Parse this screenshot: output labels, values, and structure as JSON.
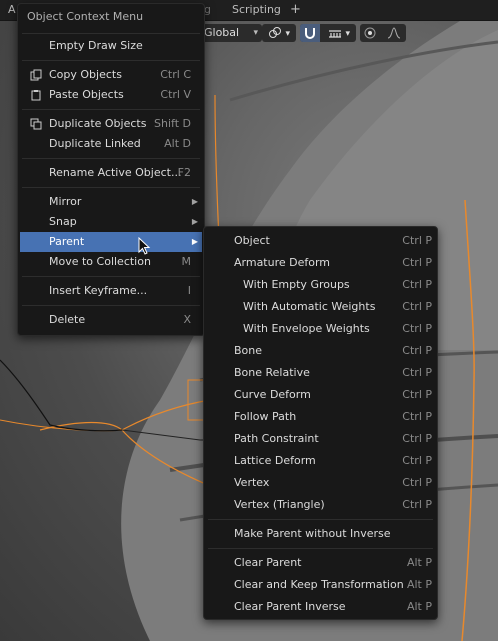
{
  "topbar": {
    "tab_partial_left": "A",
    "tab_partial_mid": "...scaping",
    "tab_scripting": "Scripting",
    "tab_add": "+"
  },
  "toolbar": {
    "orientation": "Global",
    "orientation_icon": "orientation-icon",
    "pivot_icon": "link-icon",
    "snap_icon": "magnet-icon",
    "snap_target_icon": "grid-snap-icon",
    "proportional_icon": "proportional-edit-icon",
    "falloff_icon": "falloff-curve-icon"
  },
  "context_menu": {
    "title": "Object Context Menu",
    "items": [
      {
        "label": "Empty Draw Size",
        "shortcut": ""
      },
      {
        "label": "Copy Objects",
        "shortcut": "Ctrl C",
        "icon": "copy-icon"
      },
      {
        "label": "Paste Objects",
        "shortcut": "Ctrl V",
        "icon": "paste-icon"
      },
      {
        "label": "Duplicate Objects",
        "shortcut": "Shift D",
        "icon": "duplicate-icon"
      },
      {
        "label": "Duplicate Linked",
        "shortcut": "Alt D"
      },
      {
        "label": "Rename Active Object...",
        "shortcut": "F2"
      },
      {
        "label": "Mirror",
        "shortcut": ""
      },
      {
        "label": "Snap",
        "shortcut": ""
      },
      {
        "label": "Parent",
        "shortcut": ""
      },
      {
        "label": "Move to Collection",
        "shortcut": "M"
      },
      {
        "label": "Insert Keyframe...",
        "shortcut": "I"
      },
      {
        "label": "Delete",
        "shortcut": "X"
      }
    ]
  },
  "parent_menu": {
    "items": [
      {
        "label": "Object",
        "shortcut": "Ctrl P"
      },
      {
        "label": "Armature Deform",
        "shortcut": "Ctrl P"
      },
      {
        "label": "With Empty Groups",
        "shortcut": "Ctrl P"
      },
      {
        "label": "With Automatic Weights",
        "shortcut": "Ctrl P"
      },
      {
        "label": "With Envelope Weights",
        "shortcut": "Ctrl P"
      },
      {
        "label": "Bone",
        "shortcut": "Ctrl P"
      },
      {
        "label": "Bone Relative",
        "shortcut": "Ctrl P"
      },
      {
        "label": "Curve Deform",
        "shortcut": "Ctrl P"
      },
      {
        "label": "Follow Path",
        "shortcut": "Ctrl P"
      },
      {
        "label": "Path Constraint",
        "shortcut": "Ctrl P"
      },
      {
        "label": "Lattice Deform",
        "shortcut": "Ctrl P"
      },
      {
        "label": "Vertex",
        "shortcut": "Ctrl P"
      },
      {
        "label": "Vertex (Triangle)",
        "shortcut": "Ctrl P"
      },
      {
        "label": "Make Parent without Inverse",
        "shortcut": ""
      },
      {
        "label": "Clear Parent",
        "shortcut": "Alt P"
      },
      {
        "label": "Clear and Keep Transformation",
        "shortcut": "Alt P"
      },
      {
        "label": "Clear Parent Inverse",
        "shortcut": "Alt P"
      }
    ]
  },
  "colors": {
    "highlight": "#4772b3",
    "selection_outline": "#e8892c",
    "menu_bg": "#181818"
  }
}
